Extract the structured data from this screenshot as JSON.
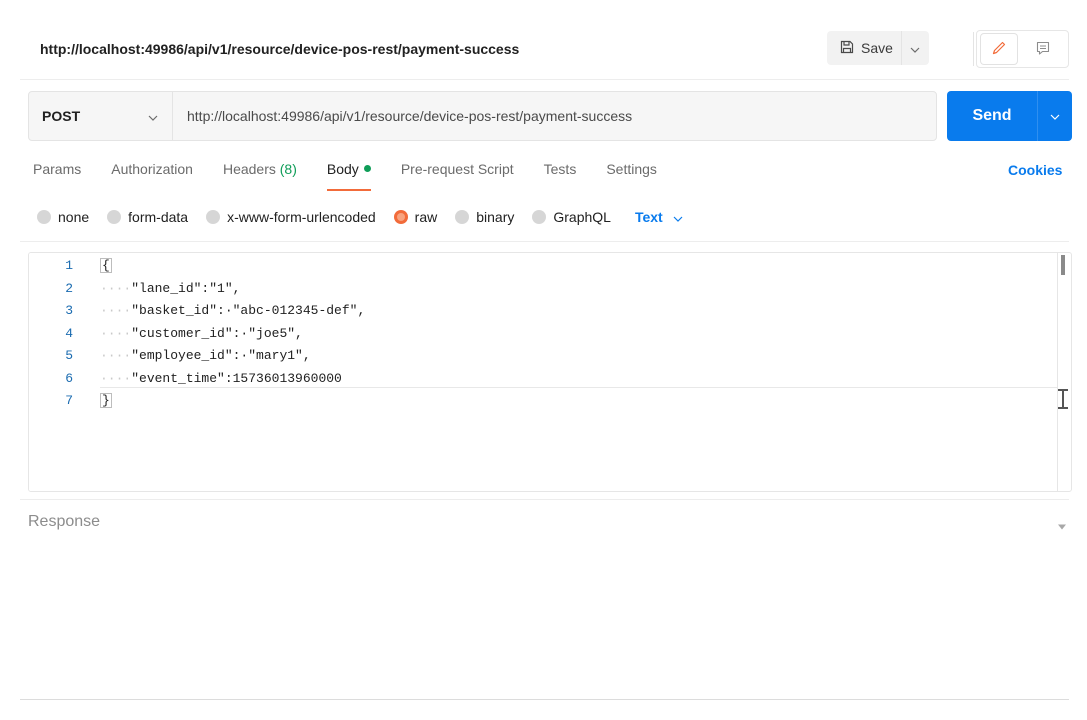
{
  "header": {
    "request_name": "http://localhost:49986/api/v1/resource/device-pos-rest/payment-success",
    "save_label": "Save"
  },
  "request": {
    "method": "POST",
    "url": "http://localhost:49986/api/v1/resource/device-pos-rest/payment-success",
    "send_label": "Send"
  },
  "tabs": {
    "params": "Params",
    "authorization": "Authorization",
    "headers": "Headers",
    "headers_count": "(8)",
    "body": "Body",
    "prerequest": "Pre-request Script",
    "tests": "Tests",
    "settings": "Settings",
    "cookies": "Cookies"
  },
  "body_types": {
    "none": "none",
    "form_data": "form-data",
    "urlencoded": "x-www-form-urlencoded",
    "raw": "raw",
    "binary": "binary",
    "graphql": "GraphQL",
    "format": "Text"
  },
  "editor": {
    "line_numbers": [
      "1",
      "2",
      "3",
      "4",
      "5",
      "6",
      "7"
    ],
    "lines": [
      {
        "indent": "",
        "text": "{"
      },
      {
        "indent": "····",
        "text": "\"lane_id\":\"1\","
      },
      {
        "indent": "····",
        "text": "\"basket_id\":·\"abc-012345-def\","
      },
      {
        "indent": "····",
        "text": "\"customer_id\":·\"joe5\","
      },
      {
        "indent": "····",
        "text": "\"employee_id\":·\"mary1\","
      },
      {
        "indent": "····",
        "text": "\"event_time\":15736013960000"
      },
      {
        "indent": "",
        "text": "}"
      }
    ]
  },
  "response": {
    "title": "Response"
  },
  "colors": {
    "accent_blue": "#097bed",
    "tab_underline": "#f26b3a",
    "status_green": "#0f9d58"
  },
  "icons": {
    "save": "save-icon",
    "edit": "pencil-icon",
    "comments": "comment-icon"
  }
}
